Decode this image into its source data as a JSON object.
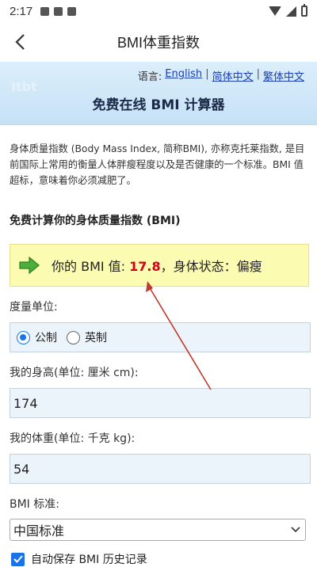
{
  "status_bar": {
    "time": "2:17"
  },
  "app": {
    "title": "BMI体重指数"
  },
  "banner": {
    "logo_text": "Itbt",
    "lang_label": "语言:",
    "languages": [
      "English",
      "简体中文",
      "繁体中文"
    ],
    "title": "免费在线 BMI 计算器"
  },
  "intro": {
    "text": "身体质量指数 (Body Mass Index, 简称BMI), 亦称克托莱指数, 是目前国际上常用的衡量人体胖瘦程度以及是否健康的一个标准。BMI 值超标，意味着你必须减肥了。"
  },
  "section_title": "免费计算你的身体质量指数 (BMI)",
  "result": {
    "prefix": "你的 BMI 值: ",
    "bmi": "17.8",
    "suffix": "，身体状态：偏瘦"
  },
  "form": {
    "unit_label": "度量单位:",
    "unit_options": [
      "公制",
      "英制"
    ],
    "unit_selected": "公制",
    "height_label": "我的身高(单位: 厘米 cm):",
    "height_value": "174",
    "weight_label": "我的体重(单位: 千克 kg):",
    "weight_value": "54",
    "standard_label": "BMI 标准:",
    "standard_value": "中国标准",
    "save_history_label": "自动保存 BMI 历史记录",
    "save_history_checked": true
  },
  "colors": {
    "accent": "#1a73e8",
    "bmi_value": "#d0021b",
    "result_bg": "#fbfbb2",
    "annotation": "#c0392b"
  }
}
